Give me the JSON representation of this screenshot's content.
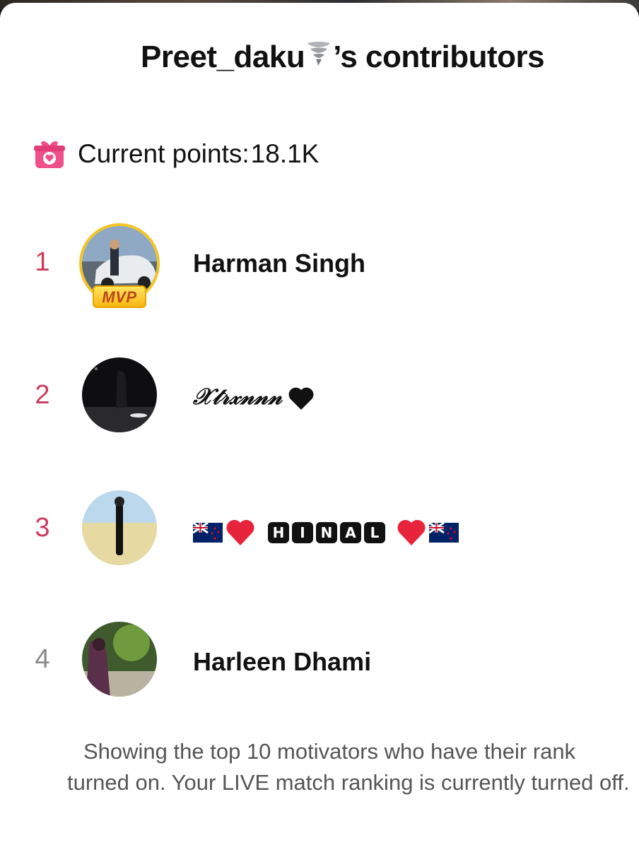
{
  "header": {
    "title_prefix": "Preet_daku",
    "title_suffix": "’s contributors"
  },
  "points": {
    "label": "Current points:",
    "value": "18.1K"
  },
  "contributors": [
    {
      "rank": "1",
      "name": "Harman Singh",
      "badge": "MVP"
    },
    {
      "rank": "2",
      "name": "𝒳𝓉𝓇𝓍𝓃𝓃𝓃"
    },
    {
      "rank": "3",
      "letters": [
        "H",
        "I",
        "N",
        "A",
        "L"
      ]
    },
    {
      "rank": "4",
      "name": "Harleen Dhami"
    }
  ],
  "footer": {
    "line1": "Showing the top 10 motivators who have their rank",
    "line2": "turned on. Your LIVE match ranking is currently turned off."
  },
  "colors": {
    "rank_top": "#cc3b5c",
    "rank_plain": "#8a8a8a",
    "mvp_gold": "#f3c425",
    "gift_pink": "#f0508a"
  },
  "icons": {
    "title_emoji": "tornado-icon",
    "points_icon": "gift-icon",
    "rank2_emoji": "black-heart-icon",
    "rank3_emojis": [
      "new-zealand-flag-icon",
      "red-heart-icon"
    ]
  }
}
